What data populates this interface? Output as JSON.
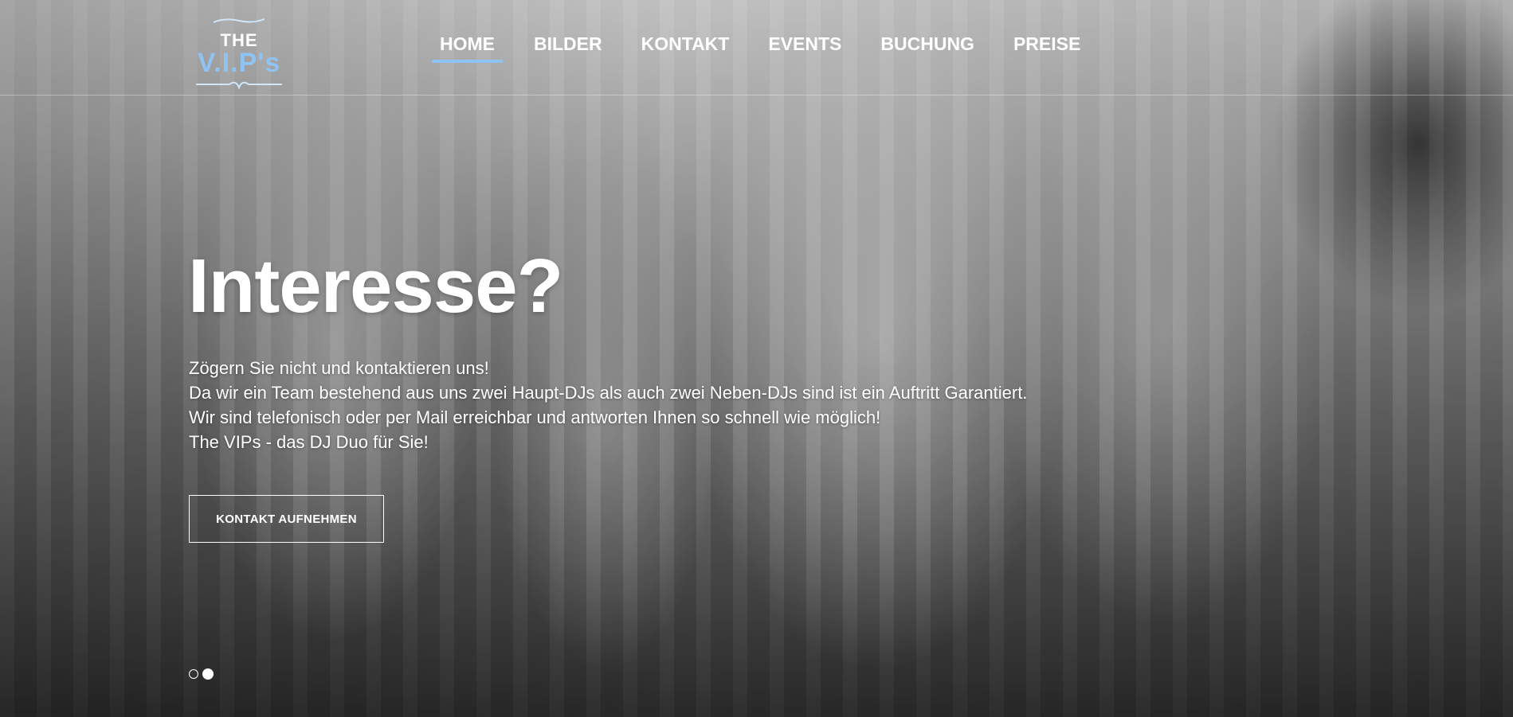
{
  "brand": {
    "logo_top": "THE",
    "logo_main": "V.I.P's",
    "accent_color": "#8fc3f2"
  },
  "nav": {
    "items": [
      {
        "label": "HOME",
        "active": true
      },
      {
        "label": "BILDER",
        "active": false
      },
      {
        "label": "KONTAKT",
        "active": false
      },
      {
        "label": "EVENTS",
        "active": false
      },
      {
        "label": "BUCHUNG",
        "active": false
      },
      {
        "label": "PREISE",
        "active": false
      }
    ]
  },
  "hero": {
    "headline": "Interesse?",
    "lines": [
      "Zögern Sie nicht und kontaktieren uns!",
      "Da wir ein Team bestehend aus uns zwei Haupt-DJs als auch zwei Neben-DJs sind ist ein Auftritt Garantiert.",
      "Wir sind telefonisch oder per Mail erreichbar und antworten Ihnen so schnell wie möglich!",
      "The VIPs - das DJ Duo für Sie!"
    ],
    "cta_label": "KONTAKT AUFNEHMEN"
  },
  "slider": {
    "slide_count": 2,
    "active_slide": 2
  }
}
